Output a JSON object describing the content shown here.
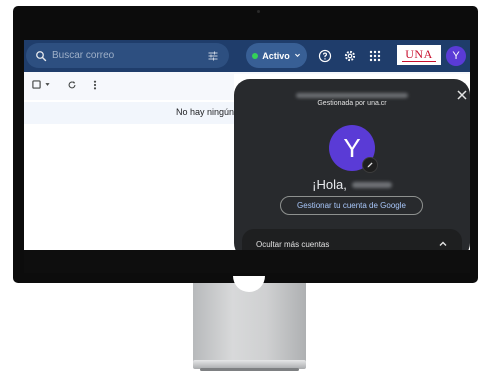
{
  "gmail": {
    "search": {
      "placeholder": "Buscar correo"
    },
    "status": {
      "label": "Activo"
    },
    "account_avatar_letter": "Y",
    "org_logo_text": "UNA",
    "empty_message": "No hay ningún"
  },
  "account_popup": {
    "managed_by": "Gestionada por una.cr",
    "avatar_letter": "Y",
    "greeting": "¡Hola,",
    "manage_account_label": "Gestionar tu cuenta de Google",
    "hide_accounts_label": "Ocultar más cuentas"
  },
  "colors": {
    "header_bg": "#1f3d6b",
    "avatar": "#5a3bd6",
    "status_dot": "#34d158",
    "popup_bg": "#282a2d",
    "link_blue": "#a8c7fa"
  },
  "icons": [
    "search-icon",
    "tune-icon",
    "help-icon",
    "settings-icon",
    "apps-icon",
    "checkbox-icon",
    "chevron-down-icon",
    "refresh-icon",
    "more-vert-icon",
    "close-icon",
    "edit-pencil-icon",
    "chevron-up-icon"
  ]
}
